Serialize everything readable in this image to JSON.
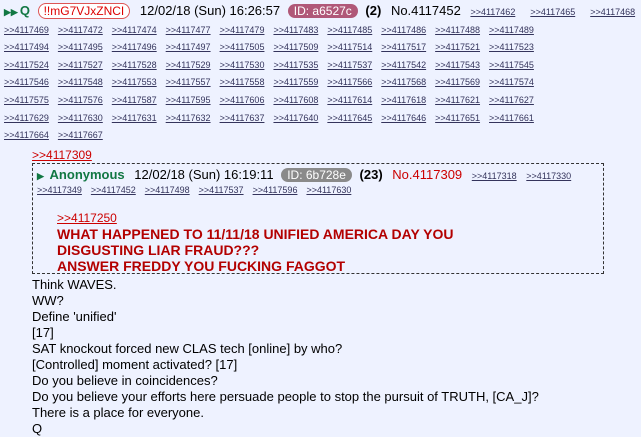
{
  "post": {
    "arrows": "▶▶",
    "name": "Q",
    "tripcode": "!!mG7VJxZNCI",
    "datetime": "12/02/18 (Sun) 16:26:57",
    "id": "ID: a6527c",
    "count": "(2)",
    "number": "No.4117452",
    "replies": [
      ">>4117462",
      ">>4117465",
      ">>4117468",
      ">>4117469",
      ">>4117472",
      ">>4117474",
      ">>4117477",
      ">>4117479",
      ">>4117483",
      ">>4117485",
      ">>4117486",
      ">>4117488",
      ">>4117489",
      ">>4117494",
      ">>4117495",
      ">>4117496",
      ">>4117497",
      ">>4117505",
      ">>4117509",
      ">>4117514",
      ">>4117517",
      ">>4117521",
      ">>4117523",
      ">>4117524",
      ">>4117527",
      ">>4117528",
      ">>4117529",
      ">>4117530",
      ">>4117535",
      ">>4117537",
      ">>4117542",
      ">>4117543",
      ">>4117545",
      ">>4117546",
      ">>4117548",
      ">>4117553",
      ">>4117557",
      ">>4117558",
      ">>4117559",
      ">>4117566",
      ">>4117568",
      ">>4117569",
      ">>4117574",
      ">>4117575",
      ">>4117576",
      ">>4117587",
      ">>4117595",
      ">>4117606",
      ">>4117608",
      ">>4117614",
      ">>4117618",
      ">>4117621",
      ">>4117627",
      ">>4117629",
      ">>4117630",
      ">>4117631",
      ">>4117632",
      ">>4117637",
      ">>4117640",
      ">>4117645",
      ">>4117646",
      ">>4117651",
      ">>4117661",
      ">>4117664",
      ">>4117667"
    ],
    "quote_ref": ">>4117309",
    "body": [
      "Think WAVES.",
      "WW?",
      "Define 'unified'",
      "[17]",
      "SAT knockout forced new CLAS tech [online] by who?",
      "[Controlled] moment activated? [17]",
      "Do you believe in coincidences?",
      "Do you believe your efforts here persuade people to stop the pursuit of TRUTH, [CA_J]?",
      "There is a place for everyone.",
      "Q"
    ]
  },
  "quoted_post": {
    "arrows": "▶",
    "name": "Anonymous",
    "datetime": "12/02/18 (Sun) 16:19:11",
    "id": "ID: 6b728e",
    "count": "(23)",
    "number": "No.4117309",
    "header_replies": [
      ">>4117318",
      ">>4117330"
    ],
    "replies": [
      ">>4117349",
      ">>4117452",
      ">>4117498",
      ">>4117537",
      ">>4117596",
      ">>4117630"
    ],
    "inner_ref": ">>4117250",
    "shout": [
      "WHAT HAPPENED TO 11/11/18 UNIFIED AMERICA DAY YOU",
      "DISGUSTING LIAR FRAUD???",
      "ANSWER FREDDY YOU FUCKING FAGGOT"
    ]
  }
}
